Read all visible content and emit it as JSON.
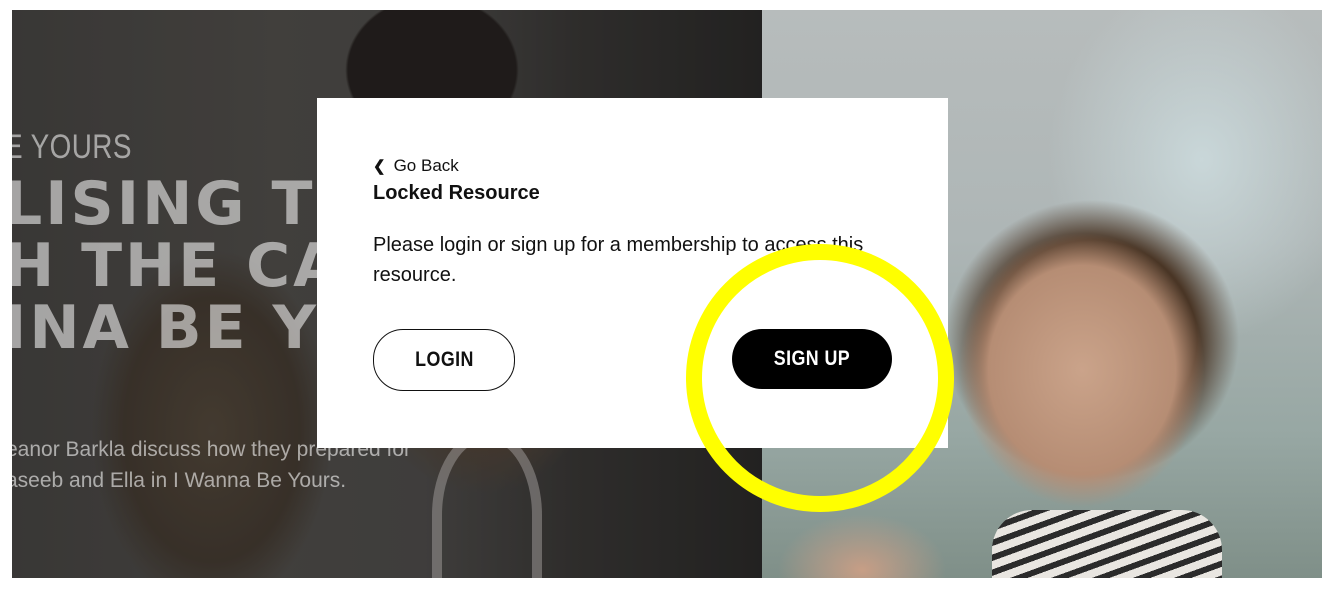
{
  "hero": {
    "eyebrow": "E YOURS",
    "headline_lines": [
      "LISING TH",
      "H THE CA",
      "INA BE Y"
    ],
    "subtext_lines": [
      "eanor Barkla discuss how they prepared for",
      "aseeb and Ella in I Wanna Be Yours."
    ]
  },
  "modal": {
    "back_label": "Go Back",
    "title": "Locked Resource",
    "message": "Please login or sign up for a membership to access this resource.",
    "login_label": "LOGIN",
    "signup_label": "SIGN UP"
  },
  "colors": {
    "highlight": "#ffff00",
    "signup_bg": "#000000",
    "modal_bg": "#ffffff"
  }
}
